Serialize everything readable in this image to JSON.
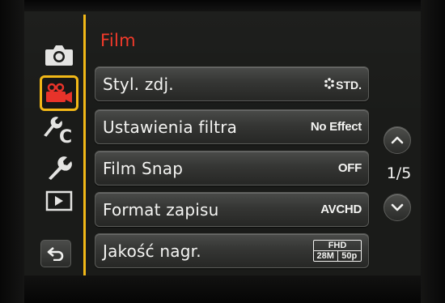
{
  "menu": {
    "title": "Film",
    "page_indicator": "1/5",
    "items": [
      {
        "label": "Styl. zdj.",
        "value": "STD."
      },
      {
        "label": "Ustawienia filtra",
        "value": "No Effect"
      },
      {
        "label": "Film Snap",
        "value": "OFF"
      },
      {
        "label": "Format zapisu",
        "value": "AVCHD"
      },
      {
        "label": "Jakość nagr.",
        "value": {
          "top": "FHD",
          "left": "28M",
          "right": "50p"
        }
      }
    ]
  },
  "sidebar": {
    "tabs": [
      {
        "icon": "camera-icon",
        "active": false
      },
      {
        "icon": "video-camera-icon",
        "active": true
      },
      {
        "icon": "custom-wrench-icon",
        "active": false
      },
      {
        "icon": "wrench-icon",
        "active": false
      },
      {
        "icon": "playback-icon",
        "active": false
      }
    ],
    "back_icon": "back-arrow-icon"
  },
  "colors": {
    "accent": "#f2b817",
    "title": "#f23a2a",
    "text": "#f4f4f2"
  }
}
